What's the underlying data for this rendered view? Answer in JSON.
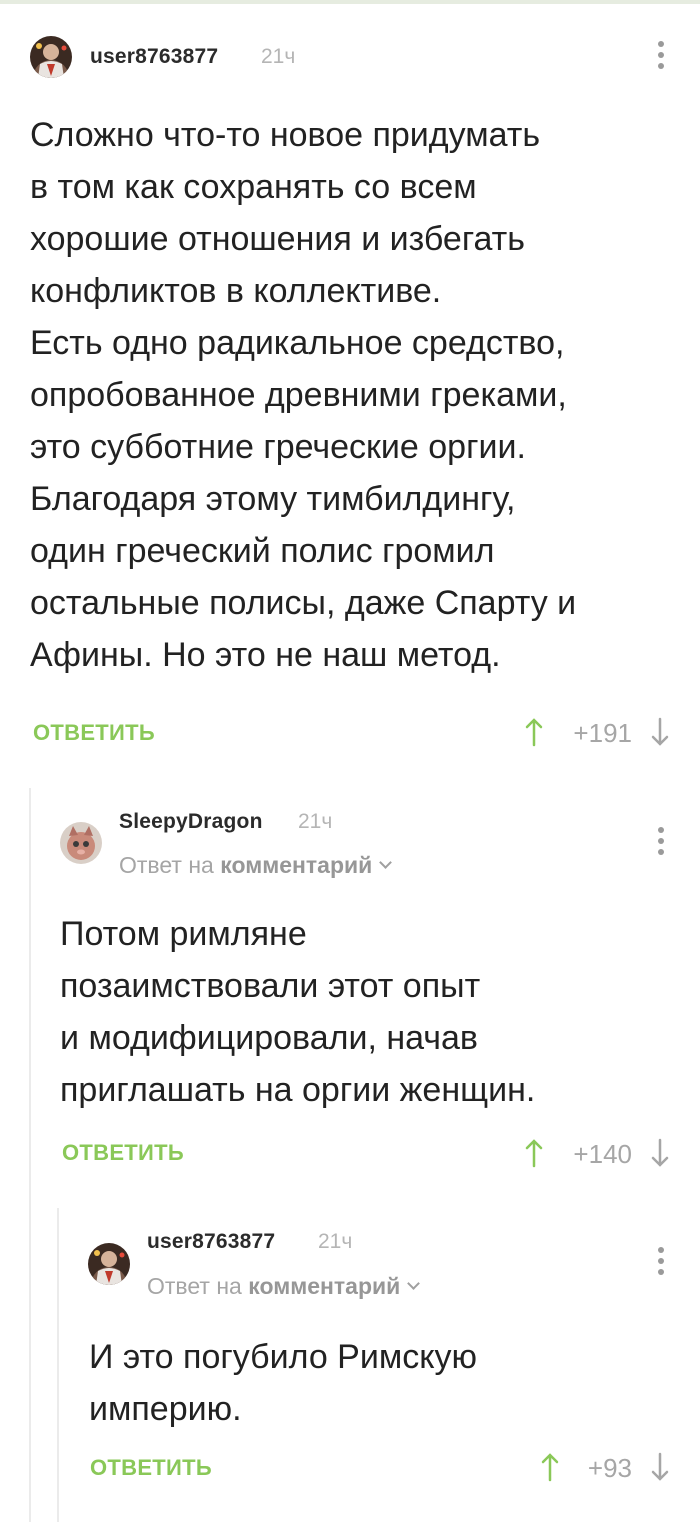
{
  "comments": [
    {
      "username": "user8763877",
      "time": "21ч",
      "text_lines": [
        "Сложно что-то новое придумать",
        "в том как сохранять со всем",
        "хорошие отношения и избегать",
        "конфликтов в коллективе.",
        "Есть одно радикальное средство,",
        "опробованное древними греками,",
        "это субботние греческие оргии.",
        "Благодаря этому тимбилдингу,",
        "один греческий полис громил",
        "остальные полисы, даже Спарту и",
        "Афины. Но это не наш метод."
      ],
      "reply_label": "ОТВЕТИТЬ",
      "rating": "+191"
    },
    {
      "username": "SleepyDragon",
      "time": "21ч",
      "reply_prefix": "Ответ на",
      "reply_target": "комментарий",
      "text_lines": [
        "Потом римляне",
        "позаимствовали этот опыт",
        "и модифицировали, начав",
        "приглашать на оргии женщин."
      ],
      "reply_label": "ОТВЕТИТЬ",
      "rating": "+140"
    },
    {
      "username": "user8763877",
      "time": "21ч",
      "reply_prefix": "Ответ на",
      "reply_target": "комментарий",
      "text_lines": [
        "И это погубило Римскую",
        "империю."
      ],
      "reply_label": "ОТВЕТИТЬ",
      "rating": "+93"
    }
  ],
  "colors": {
    "accent_green": "#8ac858",
    "muted_gray": "#a6a6a6"
  },
  "icons": [
    "avatar-user8763877",
    "avatar-sleepydragon",
    "more-options-icon",
    "vote-up-icon",
    "vote-down-icon",
    "chevron-down-icon"
  ]
}
